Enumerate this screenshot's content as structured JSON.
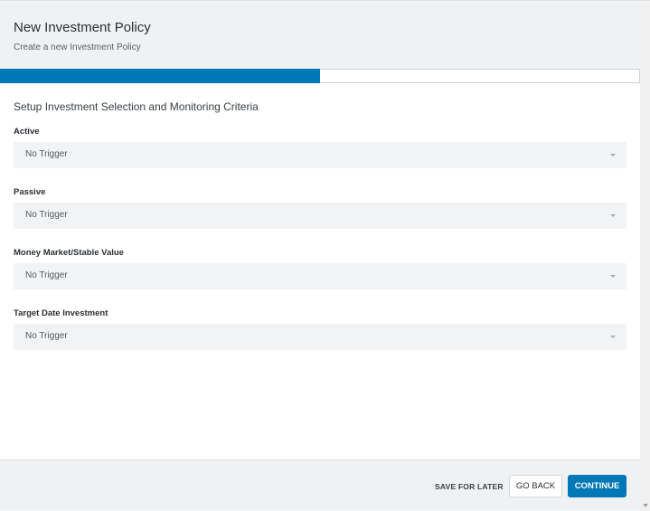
{
  "header": {
    "title": "New Investment Policy",
    "subtitle": "Create a new Investment Policy"
  },
  "progress": {
    "fraction": 0.5
  },
  "section": {
    "title": "Setup Investment Selection and Monitoring Criteria",
    "fields": [
      {
        "label": "Active",
        "value": "No Trigger"
      },
      {
        "label": "Passive",
        "value": "No Trigger"
      },
      {
        "label": "Money Market/Stable Value",
        "value": "No Trigger"
      },
      {
        "label": "Target Date Investment",
        "value": "No Trigger"
      }
    ]
  },
  "footer": {
    "save_label": "SAVE FOR LATER",
    "back_label": "GO BACK",
    "continue_label": "CONTINUE"
  },
  "colors": {
    "accent": "#0077b6",
    "panel": "#eff1f2",
    "field": "#f2f3f4"
  },
  "icons": {
    "select_caret": "caret-down-icon",
    "scroll_down": "scroll-down-icon"
  }
}
